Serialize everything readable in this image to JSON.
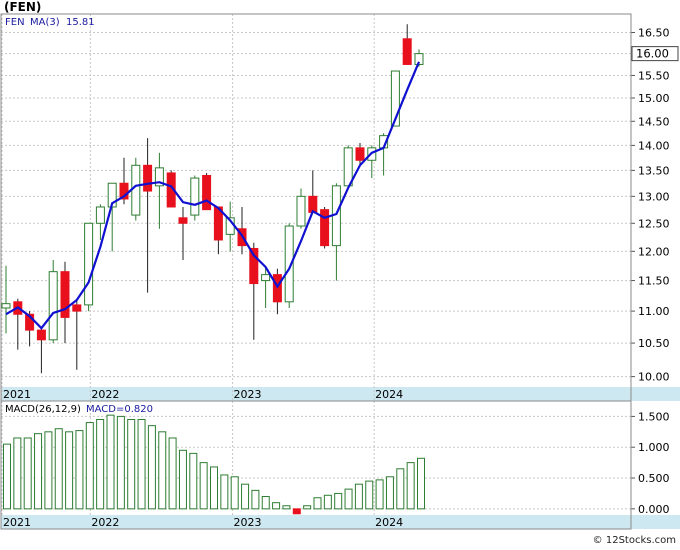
{
  "header": {
    "ticker_label": "(FEN)",
    "legend_symbol": "FEN",
    "legend_ma_label": "MA(3)",
    "legend_ma_value": "15.81",
    "macd_label": "MACD(26,12,9)",
    "macd_value_label": "MACD=0.820",
    "last_price_tag": "16.00",
    "watermark": "© 12Stocks.com"
  },
  "colors": {
    "up_candle_outline": "#2e7d32",
    "down_candle_fill": "#e8101c",
    "ma_line": "#1010d0",
    "macd_bar": "#2e7d32",
    "macd_negative": "#e8101c",
    "axis_strip": "#cde8f0",
    "grid": "#c8c8c8",
    "legend_text": "#1a1aa0"
  },
  "chart_data": [
    {
      "type": "candlestick",
      "name": "price",
      "x_tick_labels": [
        "2021",
        "2022",
        "2023",
        "2024"
      ],
      "y_tick_labels": [
        "10.00",
        "10.50",
        "11.00",
        "11.50",
        "12.00",
        "12.50",
        "13.00",
        "13.50",
        "14.00",
        "14.50",
        "15.00",
        "15.50",
        "16.00",
        "16.50"
      ],
      "y_scale": "log",
      "ylim": [
        9.85,
        16.95
      ],
      "grid": true,
      "candles": [
        {
          "open": 11.05,
          "high": 11.75,
          "low": 10.65,
          "close": 11.12
        },
        {
          "open": 11.15,
          "high": 11.2,
          "low": 10.4,
          "close": 10.95
        },
        {
          "open": 10.95,
          "high": 11.0,
          "low": 10.45,
          "close": 10.7
        },
        {
          "open": 10.7,
          "high": 10.75,
          "low": 10.05,
          "close": 10.55
        },
        {
          "open": 10.55,
          "high": 11.85,
          "low": 10.5,
          "close": 11.65
        },
        {
          "open": 11.65,
          "high": 11.82,
          "low": 10.5,
          "close": 10.9
        },
        {
          "open": 11.1,
          "high": 11.2,
          "low": 10.1,
          "close": 11.0
        },
        {
          "open": 11.1,
          "high": 12.35,
          "low": 11.0,
          "close": 12.5
        },
        {
          "open": 12.5,
          "high": 12.85,
          "low": 12.2,
          "close": 12.8
        },
        {
          "open": 12.8,
          "high": 13.25,
          "low": 12.0,
          "close": 13.25
        },
        {
          "open": 13.25,
          "high": 13.75,
          "low": 12.85,
          "close": 12.95
        },
        {
          "open": 12.65,
          "high": 13.75,
          "low": 12.55,
          "close": 13.6
        },
        {
          "open": 13.6,
          "high": 14.15,
          "low": 11.3,
          "close": 13.1
        },
        {
          "open": 13.2,
          "high": 13.85,
          "low": 12.4,
          "close": 13.55
        },
        {
          "open": 13.45,
          "high": 13.5,
          "low": 12.8,
          "close": 12.8
        },
        {
          "open": 12.6,
          "high": 12.8,
          "low": 11.85,
          "close": 12.5
        },
        {
          "open": 12.65,
          "high": 13.4,
          "low": 12.55,
          "close": 13.35
        },
        {
          "open": 13.4,
          "high": 13.45,
          "low": 12.75,
          "close": 12.75
        },
        {
          "open": 12.8,
          "high": 12.8,
          "low": 11.95,
          "close": 12.2
        },
        {
          "open": 12.3,
          "high": 12.9,
          "low": 12.0,
          "close": 12.6
        },
        {
          "open": 12.4,
          "high": 12.8,
          "low": 11.95,
          "close": 12.1
        },
        {
          "open": 12.05,
          "high": 12.15,
          "low": 10.55,
          "close": 11.45
        },
        {
          "open": 11.5,
          "high": 11.75,
          "low": 11.05,
          "close": 11.6
        },
        {
          "open": 11.6,
          "high": 11.7,
          "low": 10.95,
          "close": 11.15
        },
        {
          "open": 11.15,
          "high": 12.5,
          "low": 11.05,
          "close": 12.45
        },
        {
          "open": 12.45,
          "high": 13.15,
          "low": 12.4,
          "close": 13.0
        },
        {
          "open": 13.0,
          "high": 13.5,
          "low": 12.7,
          "close": 12.7
        },
        {
          "open": 12.75,
          "high": 12.8,
          "low": 12.05,
          "close": 12.1
        },
        {
          "open": 12.1,
          "high": 13.25,
          "low": 11.5,
          "close": 13.2
        },
        {
          "open": 13.2,
          "high": 14.0,
          "low": 13.2,
          "close": 13.95
        },
        {
          "open": 13.95,
          "high": 14.05,
          "low": 13.6,
          "close": 13.7
        },
        {
          "open": 13.7,
          "high": 14.0,
          "low": 13.35,
          "close": 13.95
        },
        {
          "open": 13.95,
          "high": 14.25,
          "low": 13.4,
          "close": 14.2
        },
        {
          "open": 14.4,
          "high": 15.6,
          "low": 14.4,
          "close": 15.6
        },
        {
          "open": 16.35,
          "high": 16.7,
          "low": 15.75,
          "close": 15.75
        },
        {
          "open": 15.75,
          "high": 16.1,
          "low": 15.7,
          "close": 16.0
        }
      ],
      "ma3": [
        10.95,
        11.06,
        10.92,
        10.73,
        10.97,
        11.03,
        11.18,
        11.47,
        12.08,
        12.87,
        13.0,
        13.2,
        13.24,
        13.27,
        13.19,
        12.89,
        12.84,
        12.92,
        12.78,
        12.55,
        12.28,
        11.93,
        11.73,
        11.4,
        11.7,
        12.18,
        12.72,
        12.6,
        12.67,
        13.16,
        13.6,
        13.85,
        13.95,
        14.55,
        15.18,
        15.81
      ],
      "last_price": 16.0
    },
    {
      "type": "bar",
      "name": "macd",
      "x_tick_labels": [
        "2021",
        "2022",
        "2023",
        "2024"
      ],
      "y_tick_labels": [
        "0.000",
        "0.500",
        "1.000",
        "1.500"
      ],
      "ylim": [
        -0.1,
        1.75
      ],
      "grid": true,
      "values": [
        1.05,
        1.15,
        1.15,
        1.22,
        1.25,
        1.3,
        1.25,
        1.27,
        1.4,
        1.45,
        1.52,
        1.5,
        1.45,
        1.45,
        1.35,
        1.25,
        1.15,
        0.95,
        0.9,
        0.75,
        0.68,
        0.55,
        0.52,
        0.4,
        0.3,
        0.2,
        0.1,
        0.05,
        -0.08,
        0.05,
        0.18,
        0.22,
        0.25,
        0.32,
        0.4,
        0.45,
        0.47,
        0.52,
        0.65,
        0.75,
        0.82
      ]
    }
  ]
}
